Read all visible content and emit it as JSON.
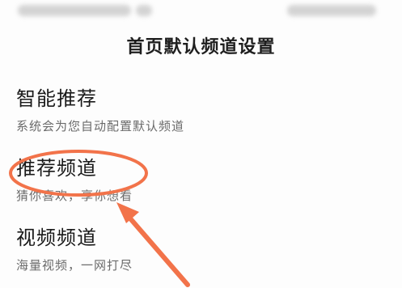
{
  "page": {
    "title": "首页默认频道设置"
  },
  "options": [
    {
      "label": "智能推荐",
      "desc": "系统会为您自动配置默认频道"
    },
    {
      "label": "推荐频道",
      "desc": "猜你喜欢，享你想看"
    },
    {
      "label": "视频频道",
      "desc": "海量视频，一网打尽"
    }
  ],
  "annotation": {
    "color": "#f2734a"
  }
}
